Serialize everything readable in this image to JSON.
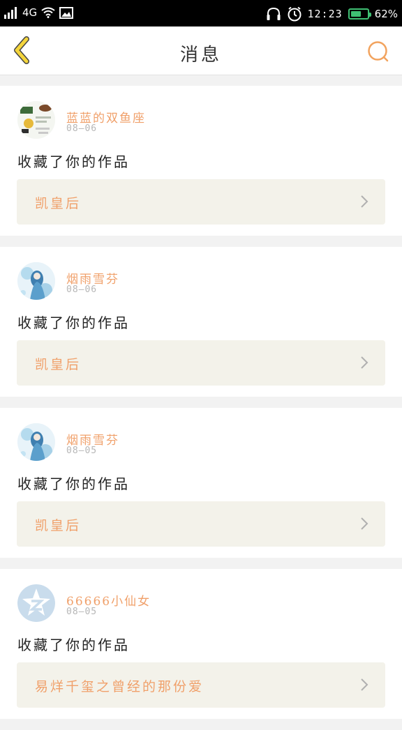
{
  "status_bar": {
    "network": "4G",
    "time": "12:23",
    "battery": "62%",
    "battery_level": 0.62
  },
  "nav": {
    "title": "消息",
    "back_icon": "back-chevron-icon",
    "search_icon": "search-icon",
    "accent_color": "#f2a35e",
    "back_color": "#f4d53c"
  },
  "feed": [
    {
      "user": "蓝蓝的双鱼座",
      "date": "08—06",
      "action": "收藏了你的作品",
      "work": "凯皇后",
      "avatar": "avatar-collage"
    },
    {
      "user": "烟雨雪芬",
      "date": "08—06",
      "action": "收藏了你的作品",
      "work": "凯皇后",
      "avatar": "avatar-blue-figure"
    },
    {
      "user": "烟雨雪芬",
      "date": "08—05",
      "action": "收藏了你的作品",
      "work": "凯皇后",
      "avatar": "avatar-blue-figure"
    },
    {
      "user": "66666小仙女",
      "date": "08—05",
      "action": "收藏了你的作品",
      "work": "易烊千玺之曾经的那份爱",
      "avatar": "avatar-default-qzone"
    }
  ]
}
